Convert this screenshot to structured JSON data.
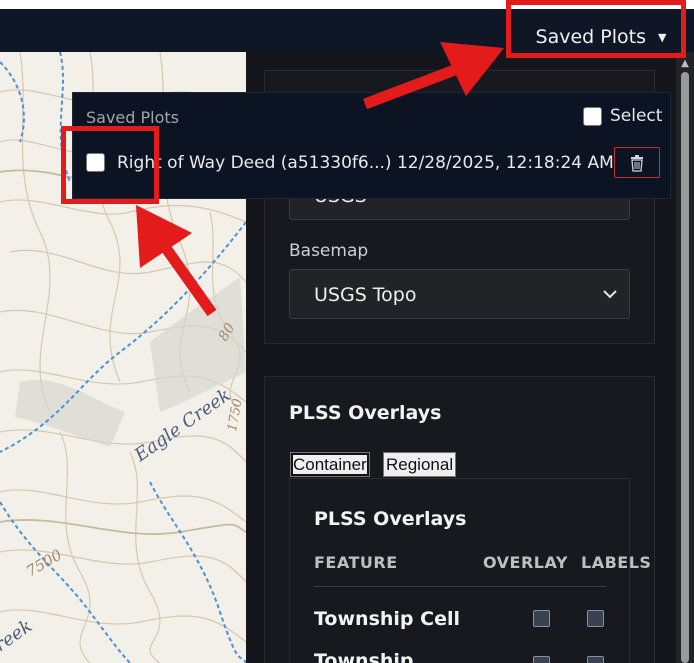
{
  "topbar": {
    "saved_plots_label": "Saved Plots",
    "caret": "▼"
  },
  "map": {
    "labels": {
      "eagle_creek": "Eagle Creek",
      "contour_7500": "7500",
      "contour_80": "80",
      "contour_1750": "1750",
      "creek": "reek"
    }
  },
  "settings": {
    "source_value": "USGS",
    "basemap_label": "Basemap",
    "basemap_value": "USGS Topo"
  },
  "plss": {
    "title": "PLSS Overlays",
    "tabs": [
      "Container",
      "Regional"
    ],
    "inner_title": "PLSS Overlays",
    "columns": {
      "feature": "FEATURE",
      "overlay": "OVERLAY",
      "labels": "LABELS"
    },
    "rows": [
      {
        "label": "Township Cell"
      },
      {
        "label": "Township"
      }
    ]
  },
  "saved_plots_dropdown": {
    "title": "Saved Plots",
    "select_label": "Select",
    "items": [
      {
        "text": "Right of Way Deed (a51330f6...) 12/28/2025, 12:18:24 AM"
      }
    ]
  },
  "colors": {
    "topbar_bg": "#0f1626",
    "panel_bg": "#15161b",
    "highlight": "#e41b1b",
    "trash_border": "#c0332b"
  },
  "icons": [
    "caret-down-icon",
    "chevron-down-icon",
    "trash-icon",
    "scroll-up-arrow-icon"
  ]
}
